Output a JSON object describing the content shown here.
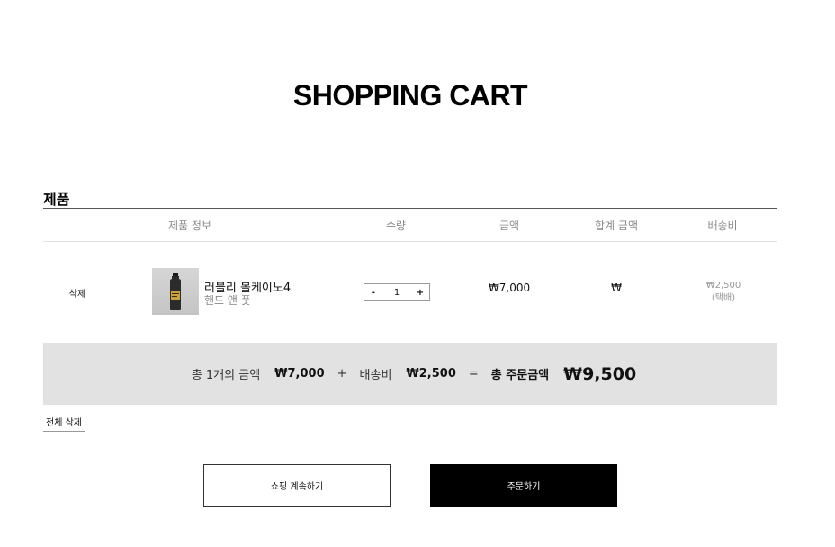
{
  "page_title": "SHOPPING CART",
  "section_title": "제품",
  "table_headers": {
    "product_info": "제품 정보",
    "quantity": "수량",
    "price": "금액",
    "total": "합계 금액",
    "shipping": "배송비"
  },
  "item": {
    "delete_label": "삭제",
    "name": "러블리 볼케이노4",
    "option": "핸드 앤 풋",
    "quantity": "1",
    "minus": "-",
    "plus": "+",
    "price": "₩7,000",
    "total": "₩",
    "shipping_fee": "₩2,500",
    "shipping_method": "(택배)"
  },
  "summary": {
    "count_label": "총 1개의 금액",
    "items_amount": "₩7,000",
    "plus_sign": "+",
    "shipping_label": "배송비",
    "shipping_amount": "₩2,500",
    "equals_sign": "=",
    "grand_label": "총 주문금액",
    "grand_amount": "₩9,500"
  },
  "clear_all_label": "전체 삭제",
  "buttons": {
    "continue_shopping": "쇼핑 계속하기",
    "order": "주문하기"
  }
}
